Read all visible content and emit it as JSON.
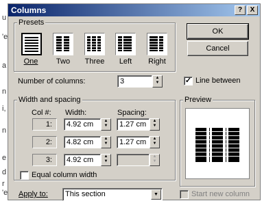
{
  "background": {
    "left_chars": [
      "u",
      "'e",
      "a",
      "n",
      "i,",
      "n",
      "e",
      "d",
      "r",
      "'e"
    ]
  },
  "title": "Columns",
  "titlebar_buttons": {
    "help": "?",
    "close": "X"
  },
  "presets": {
    "label": "Presets",
    "items": [
      {
        "label": "One",
        "icon": "one-column-icon",
        "selected": true
      },
      {
        "label": "Two",
        "icon": "two-columns-icon",
        "selected": false
      },
      {
        "label": "Three",
        "icon": "three-columns-icon",
        "selected": false
      },
      {
        "label": "Left",
        "icon": "left-columns-icon",
        "selected": false
      },
      {
        "label": "Right",
        "icon": "right-columns-icon",
        "selected": false
      }
    ]
  },
  "buttons": {
    "ok": "OK",
    "cancel": "Cancel"
  },
  "number_of_columns": {
    "label": "Number of columns:",
    "value": "3"
  },
  "line_between": {
    "label": "Line between",
    "checked": true
  },
  "width_spacing": {
    "label": "Width and spacing",
    "col_header": "Col #:",
    "width_header": "Width:",
    "spacing_header": "Spacing:",
    "rows": [
      {
        "col": "1:",
        "width": "4.92 cm",
        "spacing": "1.27 cm"
      },
      {
        "col": "2:",
        "width": "4.82 cm",
        "spacing": "1.27 cm"
      },
      {
        "col": "3:",
        "width": "4.92 cm",
        "spacing": ""
      }
    ]
  },
  "equal_column_width": {
    "label": "Equal column width",
    "checked": false
  },
  "preview": {
    "label": "Preview",
    "columns": 3
  },
  "apply_to": {
    "label": "Apply to:",
    "value": "This section"
  },
  "start_new_column": {
    "label": "Start new column",
    "checked": false
  }
}
